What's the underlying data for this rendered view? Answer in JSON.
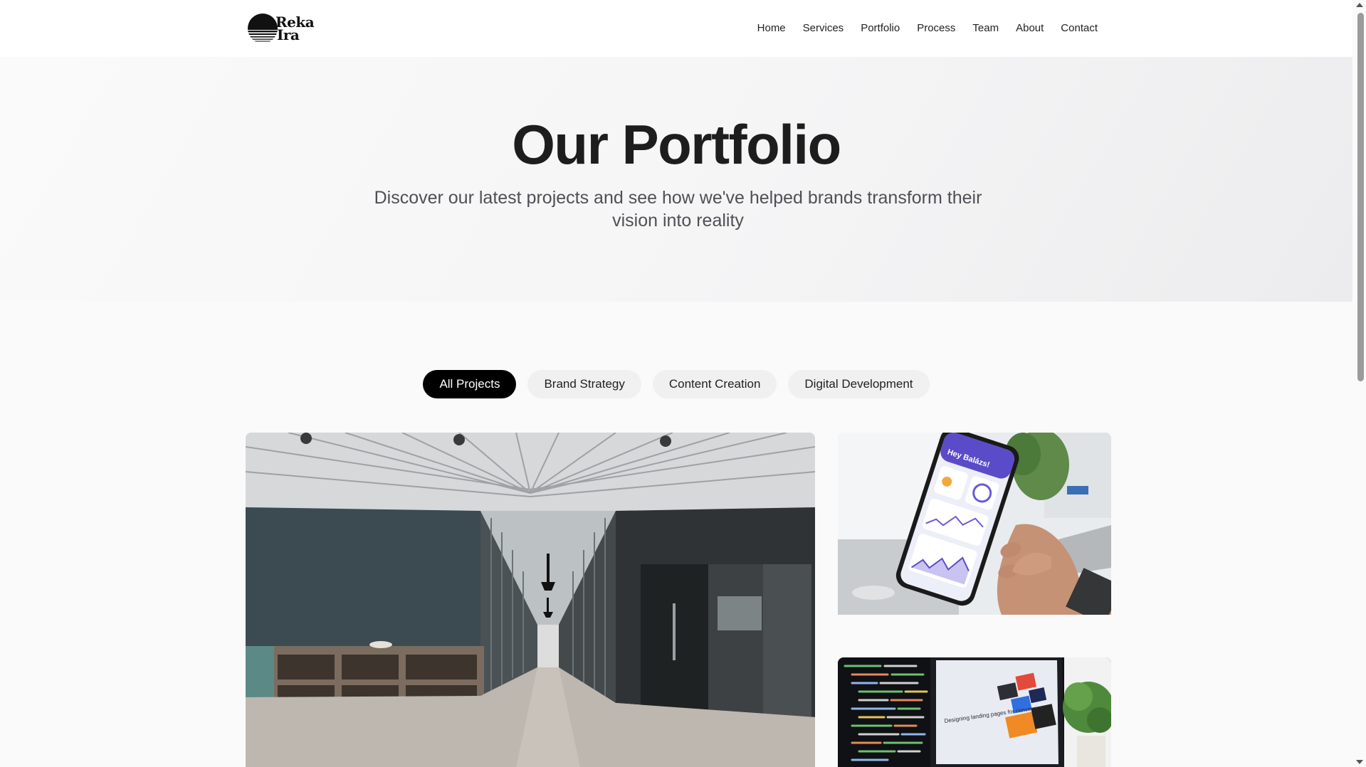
{
  "brand": {
    "name_line1": "Reka",
    "name_line2": "Ira",
    "logo_icon": "sunset-stripes-icon"
  },
  "nav": {
    "items": [
      {
        "label": "Home"
      },
      {
        "label": "Services"
      },
      {
        "label": "Portfolio"
      },
      {
        "label": "Process"
      },
      {
        "label": "Team"
      },
      {
        "label": "About"
      },
      {
        "label": "Contact"
      }
    ]
  },
  "hero": {
    "title": "Our Portfolio",
    "subtitle": "Discover our latest projects and see how we've helped brands transform their vision into reality"
  },
  "filters": {
    "items": [
      {
        "label": "All Projects",
        "active": true
      },
      {
        "label": "Brand Strategy",
        "active": false
      },
      {
        "label": "Content Creation",
        "active": false
      },
      {
        "label": "Digital Development",
        "active": false
      }
    ]
  },
  "projects": {
    "items": [
      {
        "image": "office-corridor-photo"
      },
      {
        "image": "phone-weather-app-photo",
        "screen_greeting": "Hey Balázs!"
      },
      {
        "image": "code-monitor-landing-page-photo",
        "screen_text": "Designing landing pages for conversion"
      }
    ]
  },
  "colors": {
    "accent": "#000000",
    "pill_bg": "#f0f0f1",
    "text_muted": "#4f4f55"
  }
}
